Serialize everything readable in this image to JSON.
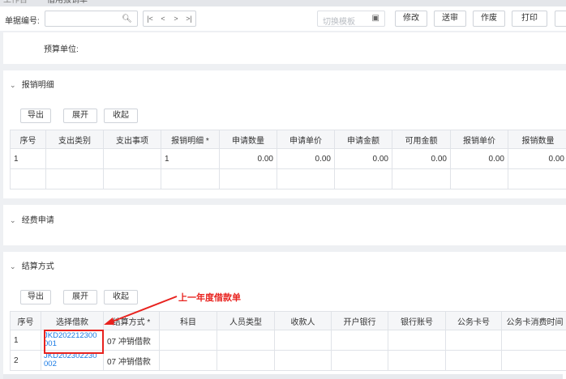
{
  "tabs": [
    "工作台",
    "借用报销单"
  ],
  "toolbar": {
    "doc_no_label": "单据编号:",
    "doc_no_value": "",
    "pager": [
      "|<",
      "<",
      ">",
      ">|"
    ],
    "template_placeholder": "切换模板",
    "buttons": [
      "修改",
      "送审",
      "作废",
      "打印"
    ]
  },
  "unit": {
    "label": "预算单位:"
  },
  "section_baoxiao": {
    "title": "报销明细",
    "actions": [
      "导出",
      "展开",
      "收起"
    ],
    "columns": [
      "序号",
      "支出类别",
      "支出事项",
      "报销明细 *",
      "申请数量",
      "申请单价",
      "申请金额",
      "可用金额",
      "报销单价",
      "报销数量"
    ],
    "rows": [
      [
        "1",
        "",
        "",
        "1",
        "0.00",
        "0.00",
        "0.00",
        "0.00",
        "0.00",
        "0.00"
      ]
    ]
  },
  "section_jingfei": {
    "title": "经费申请"
  },
  "section_jiesuan": {
    "title": "结算方式",
    "actions": [
      "导出",
      "展开",
      "收起"
    ],
    "columns": [
      "序号",
      "选择借款",
      "结算方式 *",
      "科目",
      "人员类型",
      "收款人",
      "开户银行",
      "银行账号",
      "公务卡号",
      "公务卡消费时间"
    ],
    "rows": [
      [
        "1",
        "JKD202212300001",
        "07 冲销借款",
        "",
        "",
        "",
        "",
        "",
        "",
        ""
      ],
      [
        "2",
        "JKD202302230002",
        "07 冲销借款",
        "",
        "",
        "",
        "",
        "",
        "",
        ""
      ]
    ]
  },
  "annotation": {
    "text": "上一年度借款单",
    "color": "#e8221e"
  },
  "colors": {
    "link": "#1a7be5",
    "header_bg": "#f5f6f8",
    "border": "#e0e3e8"
  }
}
